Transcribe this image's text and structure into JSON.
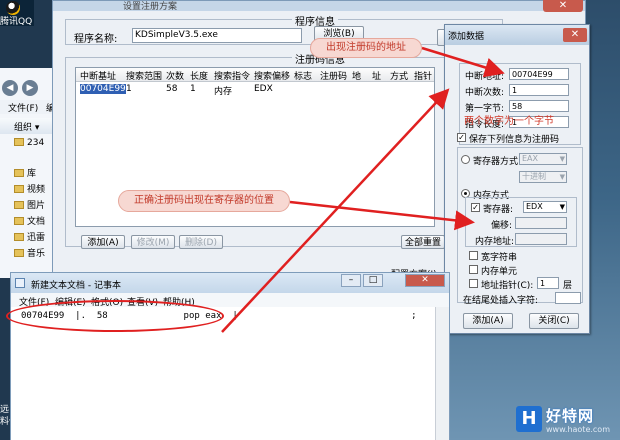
{
  "desktop": {
    "qq_label": "腾讯QQ",
    "bottom_left_1": "远",
    "bottom_left_2": "料件"
  },
  "explorer": {
    "menu": [
      "文件(F)",
      "编"
    ],
    "organize": "组织",
    "items": [
      "234",
      "库",
      "视频",
      "图片",
      "文档",
      "迅雷",
      "音乐"
    ]
  },
  "main_dialog": {
    "title": "设置注册方案",
    "program_group_title": "程序信息",
    "program_label": "程序名称:",
    "program_value": "KDSimpleV3.5.exe",
    "browse_button": "浏览(B)",
    "registry_group_title": "注册码信息",
    "columns": [
      "中断基址",
      "搜索范围",
      "次数",
      "长度",
      "搜索指令",
      "搜索偏移",
      "标志",
      "注册码",
      "地",
      "址",
      "方式",
      "指针",
      "偏"
    ],
    "row": [
      "00704E99",
      "1",
      "58",
      "1",
      "内存",
      "EDX"
    ],
    "add_button": "添加(A)",
    "modify_button": "修改(M)",
    "delete_button": "删除(D)",
    "reset_button": "全部重置",
    "scheme_label": "配置方案(J)"
  },
  "add_dialog": {
    "title": "添加数据",
    "close": "✕",
    "breakpoint_label": "中断地址:",
    "breakpoint_value": "00704E99",
    "count_label": "中断次数:",
    "count_value": "1",
    "first_byte_label": "第一字节:",
    "first_byte_value": "58",
    "length_label": "指令长度:",
    "length_value": "1",
    "save_checkbox_label": "保存下列信息为注册码",
    "register_mode_label": "寄存器方式",
    "register_mode_select": "EAX",
    "radix_select": "十进制",
    "memory_mode_label": "内存方式",
    "register_checkbox_label": "寄存器:",
    "register_value": "EDX",
    "offset_label": "偏移:",
    "memory_addr_label": "内存地址:",
    "wide_string_label": "宽字符串",
    "memory_unit_label": "内存单元",
    "addr_pointer_label": "地址指针(C):",
    "pointer_value": "1",
    "layer_label": "层",
    "insert_label": "在结尾处插入字符:",
    "ok_button": "添加(A)",
    "cancel_button": "关闭(C)"
  },
  "notepad": {
    "title": "新建文本文档 - 记事本",
    "menu": [
      "文件(F)",
      "编辑(E)",
      "格式(O)",
      "查看(V)",
      "帮助(H)"
    ],
    "line": "00704E99  |.  58              pop eax  |                                ;"
  },
  "annotations": {
    "callout_address": "出现注册码的地址",
    "callout_register": "正确注册码出现在寄存器的位置",
    "note_digits": "两个数字为一个字节"
  },
  "watermark": {
    "logo_char": "H",
    "name": "好特网",
    "url": "www.haote.com"
  },
  "colors": {
    "annotation_red": "#e02020",
    "callout_bg": "#f7d8d2",
    "selection_blue": "#2f5fb3"
  }
}
